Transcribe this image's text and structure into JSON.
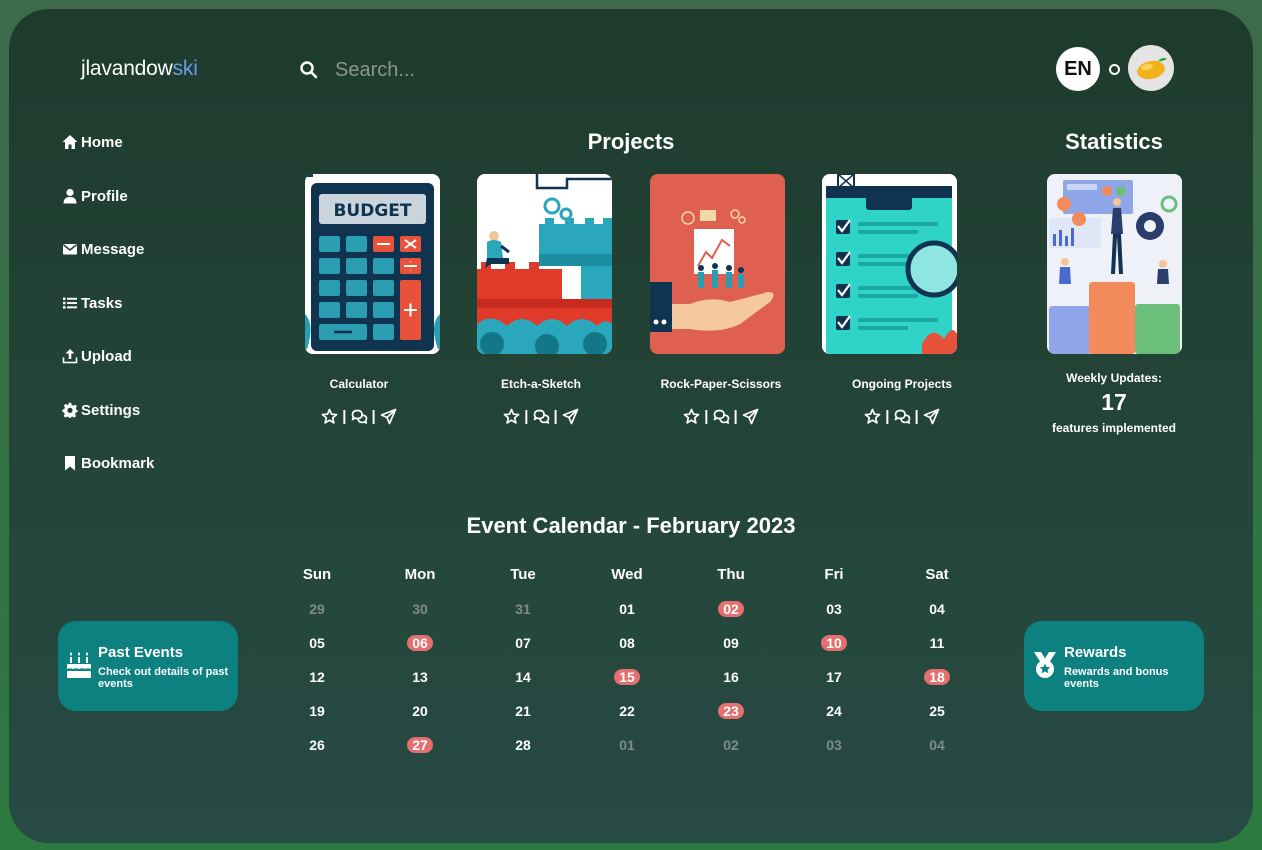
{
  "header": {
    "logo_main": "jlavandow",
    "logo_accent": "ski",
    "search_placeholder": "Search...",
    "language": "EN"
  },
  "sidebar": {
    "items": [
      {
        "label": "Home",
        "icon": "home-icon"
      },
      {
        "label": "Profile",
        "icon": "user-icon"
      },
      {
        "label": "Message",
        "icon": "envelope-icon"
      },
      {
        "label": "Tasks",
        "icon": "list-icon"
      },
      {
        "label": "Upload",
        "icon": "upload-icon"
      },
      {
        "label": "Settings",
        "icon": "gear-icon"
      },
      {
        "label": "Bookmark",
        "icon": "bookmark-icon"
      }
    ]
  },
  "projects": {
    "title": "Projects",
    "items": [
      {
        "title": "Calculator",
        "image": "budget-calculator-illustration"
      },
      {
        "title": "Etch-a-Sketch",
        "image": "building-blocks-illustration"
      },
      {
        "title": "Rock-Paper-Scissors",
        "image": "team-on-hand-illustration"
      },
      {
        "title": "Ongoing Projects",
        "image": "checklist-clipboard-illustration"
      }
    ],
    "action_icons": [
      "star-icon",
      "comments-icon",
      "share-icon"
    ],
    "separator": "|"
  },
  "statistics": {
    "title": "Statistics",
    "image": "bar-chart-team-illustration",
    "label": "Weekly Updates:",
    "value": "17",
    "caption": "features implemented"
  },
  "calendar": {
    "title": "Event Calendar - February 2023",
    "weekdays": [
      "Sun",
      "Mon",
      "Tue",
      "Wed",
      "Thu",
      "Fri",
      "Sat"
    ],
    "weeks": [
      [
        {
          "d": "29",
          "muted": true
        },
        {
          "d": "30",
          "muted": true
        },
        {
          "d": "31",
          "muted": true
        },
        {
          "d": "01"
        },
        {
          "d": "02",
          "event": true
        },
        {
          "d": "03"
        },
        {
          "d": "04"
        }
      ],
      [
        {
          "d": "05"
        },
        {
          "d": "06",
          "event": true
        },
        {
          "d": "07"
        },
        {
          "d": "08"
        },
        {
          "d": "09"
        },
        {
          "d": "10",
          "event": true
        },
        {
          "d": "11"
        }
      ],
      [
        {
          "d": "12"
        },
        {
          "d": "13"
        },
        {
          "d": "14"
        },
        {
          "d": "15",
          "event": true
        },
        {
          "d": "16"
        },
        {
          "d": "17"
        },
        {
          "d": "18",
          "event": true
        }
      ],
      [
        {
          "d": "19"
        },
        {
          "d": "20"
        },
        {
          "d": "21"
        },
        {
          "d": "22"
        },
        {
          "d": "23",
          "event": true
        },
        {
          "d": "24"
        },
        {
          "d": "25"
        }
      ],
      [
        {
          "d": "26"
        },
        {
          "d": "27",
          "event": true
        },
        {
          "d": "28"
        },
        {
          "d": "01",
          "muted": true
        },
        {
          "d": "02",
          "muted": true
        },
        {
          "d": "03",
          "muted": true
        },
        {
          "d": "04",
          "muted": true
        }
      ]
    ],
    "event_color": "#e46f6f"
  },
  "past_events": {
    "title": "Past Events",
    "description": "Check out details of past events",
    "icon": "birthday-cake-icon"
  },
  "rewards": {
    "title": "Rewards",
    "description": "Rewards and bonus events",
    "icon": "medal-icon"
  },
  "colors": {
    "background": "#1e3b2d",
    "accent": "#6b9be8",
    "card": "#0d8080",
    "event": "#e46f6f"
  }
}
